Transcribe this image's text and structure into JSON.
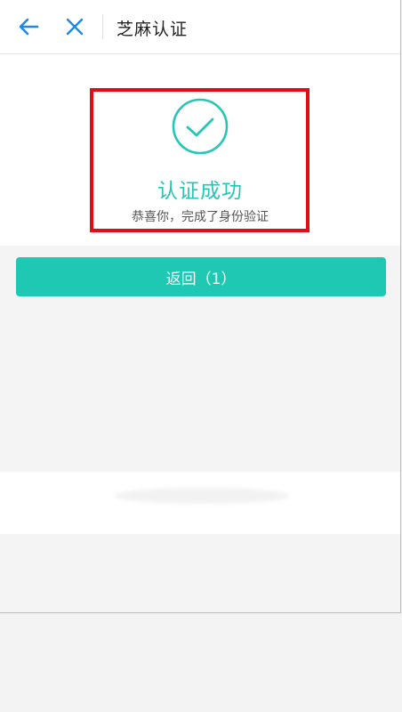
{
  "header": {
    "back_icon": "arrow-left-icon",
    "close_icon": "close-icon",
    "title": "芝麻认证"
  },
  "result": {
    "icon": "check-circle-icon",
    "title": "认证成功",
    "subtitle": "恭喜你，完成了身份验证"
  },
  "actions": {
    "return_label": "返回（1）"
  },
  "colors": {
    "accent": "#1ec8b2",
    "success_text": "#24c6b6",
    "highlight": "#e10d14",
    "header_icons": "#1e88e5"
  }
}
